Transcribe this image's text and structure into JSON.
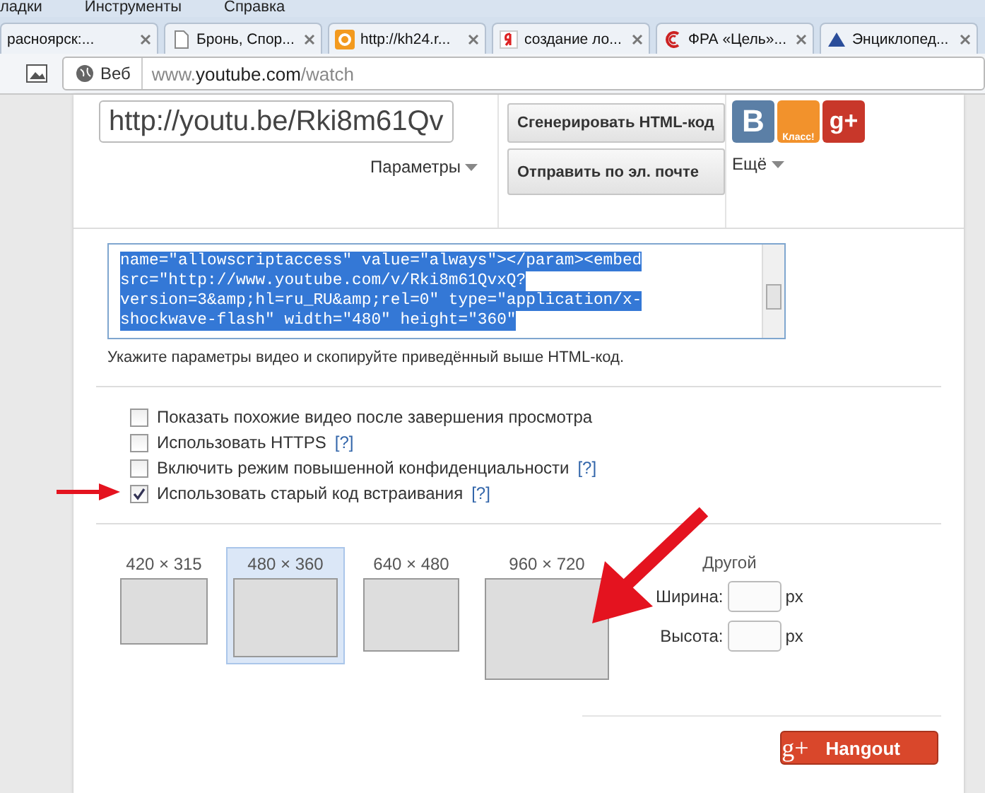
{
  "menu": [
    "ладки",
    "Инструменты",
    "Справка"
  ],
  "tabs": [
    {
      "kind": "plain",
      "title": "расноярск:...",
      "selected": false
    },
    {
      "kind": "page",
      "title": "Бронь, Спор...",
      "selected": false
    },
    {
      "kind": "letter",
      "title": "http://kh24.r...",
      "selected": false
    },
    {
      "kind": "ya",
      "title": "создание ло...",
      "selected": false
    },
    {
      "kind": "ring",
      "title": "ФРА «Цель»...",
      "selected": false
    },
    {
      "kind": "triangle",
      "title": "Энциклопед...",
      "selected": false
    }
  ],
  "address": {
    "search_label": "Веб",
    "prefix": "www.",
    "domain": "youtube.com",
    "path": "/watch"
  },
  "share": {
    "link": "http://youtu.be/Rki8m61Qv",
    "options_label": "Параметры",
    "buttons": [
      "Сгенерировать HTML-код",
      "Отправить по эл. почте"
    ],
    "more_label": "Ещё",
    "social": [
      {
        "kind": "vk",
        "label": "B"
      },
      {
        "kind": "ok",
        "label": "Класс!"
      },
      {
        "kind": "gplus",
        "label": "g+"
      }
    ]
  },
  "embed": {
    "selected": true,
    "lines": [
      "name=\"allowscriptaccess\" value=\"always\"></param><embed",
      "src=\"http://www.youtube.com/v/Rki8m61QvxQ?",
      "version=3&amp;hl=ru_RU&amp;rel=0\" type=\"application/x-",
      "shockwave-flash\" width=\"480\" height=\"360\""
    ],
    "hint": "Укажите параметры видео и скопируйте приведённый выше HTML-код."
  },
  "options": [
    {
      "label": "Показать похожие видео после завершения просмотра",
      "checked": false
    },
    {
      "label": "Использовать HTTPS",
      "help": "[?]",
      "checked": false
    },
    {
      "label": "Включить режим повышенной конфиденциальности",
      "help": "[?]",
      "checked": false
    },
    {
      "label": "Использовать старый код встраивания",
      "help": "[?]",
      "checked": true
    }
  ],
  "sizes": [
    {
      "label": "420 × 315",
      "selected": false
    },
    {
      "label": "480 × 360",
      "selected": true
    },
    {
      "label": "640 × 480",
      "selected": false
    },
    {
      "label": "960 × 720",
      "selected": false
    }
  ],
  "custom": {
    "title": "Другой",
    "fields": [
      {
        "label": "Ширина:",
        "unit": "px"
      },
      {
        "label": "Высота:",
        "unit": "px"
      }
    ]
  },
  "hangout": {
    "icon_text": "g+",
    "label": "Hangout"
  }
}
